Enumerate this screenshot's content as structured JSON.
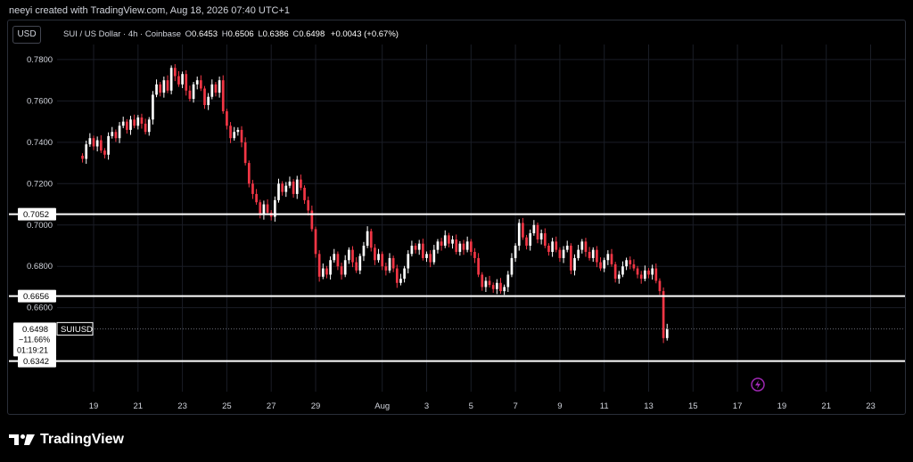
{
  "header": {
    "credit": "neeyi created with TradingView.com, Aug 18, 2026 07:40 UTC+1"
  },
  "toolbar": {
    "currency_label": "USD"
  },
  "legend": {
    "symbol": "SUI / US Dollar · 4h · Coinbase",
    "o_label": "O",
    "o_value": "0.6453",
    "h_label": "H",
    "h_value": "0.6506",
    "l_label": "L",
    "l_value": "0.6386",
    "c_label": "C",
    "c_value": "0.6498",
    "change": "+0.0043 (+0.67%)"
  },
  "price_tag": {
    "symbol": "SUIUSD",
    "price": "0.6498",
    "change_pct": "−11.66%",
    "countdown": "01:19:21"
  },
  "levels": [
    {
      "label": "0.7052",
      "value": 0.7052
    },
    {
      "label": "0.6656",
      "value": 0.6656
    },
    {
      "label": "0.6342",
      "value": 0.6342
    }
  ],
  "footer": {
    "brand": "TradingView"
  },
  "colors": {
    "up": "#ffffff",
    "down": "#f23645",
    "level": "#ffffff",
    "grid": "#1a1d26",
    "accent": "#9c27b0"
  },
  "chart_data": {
    "type": "candlestick",
    "title": "",
    "ylim": [
      0.628,
      0.786
    ],
    "y_ticks": [
      "0.7800",
      "0.7600",
      "0.7400",
      "0.7200",
      "0.7000",
      "0.6800",
      "0.6600"
    ],
    "x_ticks": [
      "19",
      "21",
      "23",
      "25",
      "27",
      "29",
      "Aug",
      "3",
      "5",
      "7",
      "9",
      "11",
      "13",
      "15",
      "17",
      "19",
      "21",
      "23"
    ],
    "x_tick_days": [
      19,
      21,
      23,
      25,
      27,
      29,
      32,
      34,
      36,
      38,
      40,
      42,
      44,
      46,
      48,
      50,
      52,
      54
    ],
    "first_candle_day": 18.5,
    "candles_per_day": 6,
    "series": [
      {
        "name": "SUIUSD",
        "values": [
          0.732,
          0.739,
          0.742,
          0.738,
          0.741,
          0.736,
          0.734,
          0.743,
          0.745,
          0.742,
          0.748,
          0.75,
          0.746,
          0.751,
          0.748,
          0.752,
          0.749,
          0.745,
          0.751,
          0.763,
          0.768,
          0.764,
          0.77,
          0.765,
          0.776,
          0.772,
          0.768,
          0.773,
          0.765,
          0.761,
          0.768,
          0.77,
          0.766,
          0.758,
          0.762,
          0.768,
          0.764,
          0.77,
          0.755,
          0.748,
          0.742,
          0.745,
          0.746,
          0.74,
          0.73,
          0.72,
          0.715,
          0.711,
          0.705,
          0.71,
          0.706,
          0.704,
          0.712,
          0.72,
          0.716,
          0.719,
          0.721,
          0.715,
          0.722,
          0.718,
          0.712,
          0.707,
          0.698,
          0.686,
          0.675,
          0.679,
          0.676,
          0.683,
          0.686,
          0.68,
          0.676,
          0.683,
          0.688,
          0.682,
          0.678,
          0.685,
          0.69,
          0.697,
          0.689,
          0.683,
          0.686,
          0.68,
          0.678,
          0.684,
          0.679,
          0.672,
          0.674,
          0.679,
          0.686,
          0.69,
          0.688,
          0.691,
          0.684,
          0.686,
          0.682,
          0.688,
          0.692,
          0.69,
          0.695,
          0.691,
          0.693,
          0.687,
          0.691,
          0.688,
          0.692,
          0.687,
          0.684,
          0.676,
          0.67,
          0.673,
          0.671,
          0.669,
          0.672,
          0.668,
          0.67,
          0.676,
          0.684,
          0.69,
          0.701,
          0.694,
          0.69,
          0.696,
          0.7,
          0.693,
          0.696,
          0.69,
          0.687,
          0.692,
          0.688,
          0.684,
          0.688,
          0.69,
          0.678,
          0.684,
          0.688,
          0.692,
          0.687,
          0.684,
          0.688,
          0.682,
          0.679,
          0.683,
          0.686,
          0.681,
          0.674,
          0.676,
          0.68,
          0.683,
          0.681,
          0.679,
          0.676,
          0.674,
          0.678,
          0.676,
          0.679,
          0.673,
          0.668,
          0.6453,
          0.6498
        ]
      }
    ]
  }
}
